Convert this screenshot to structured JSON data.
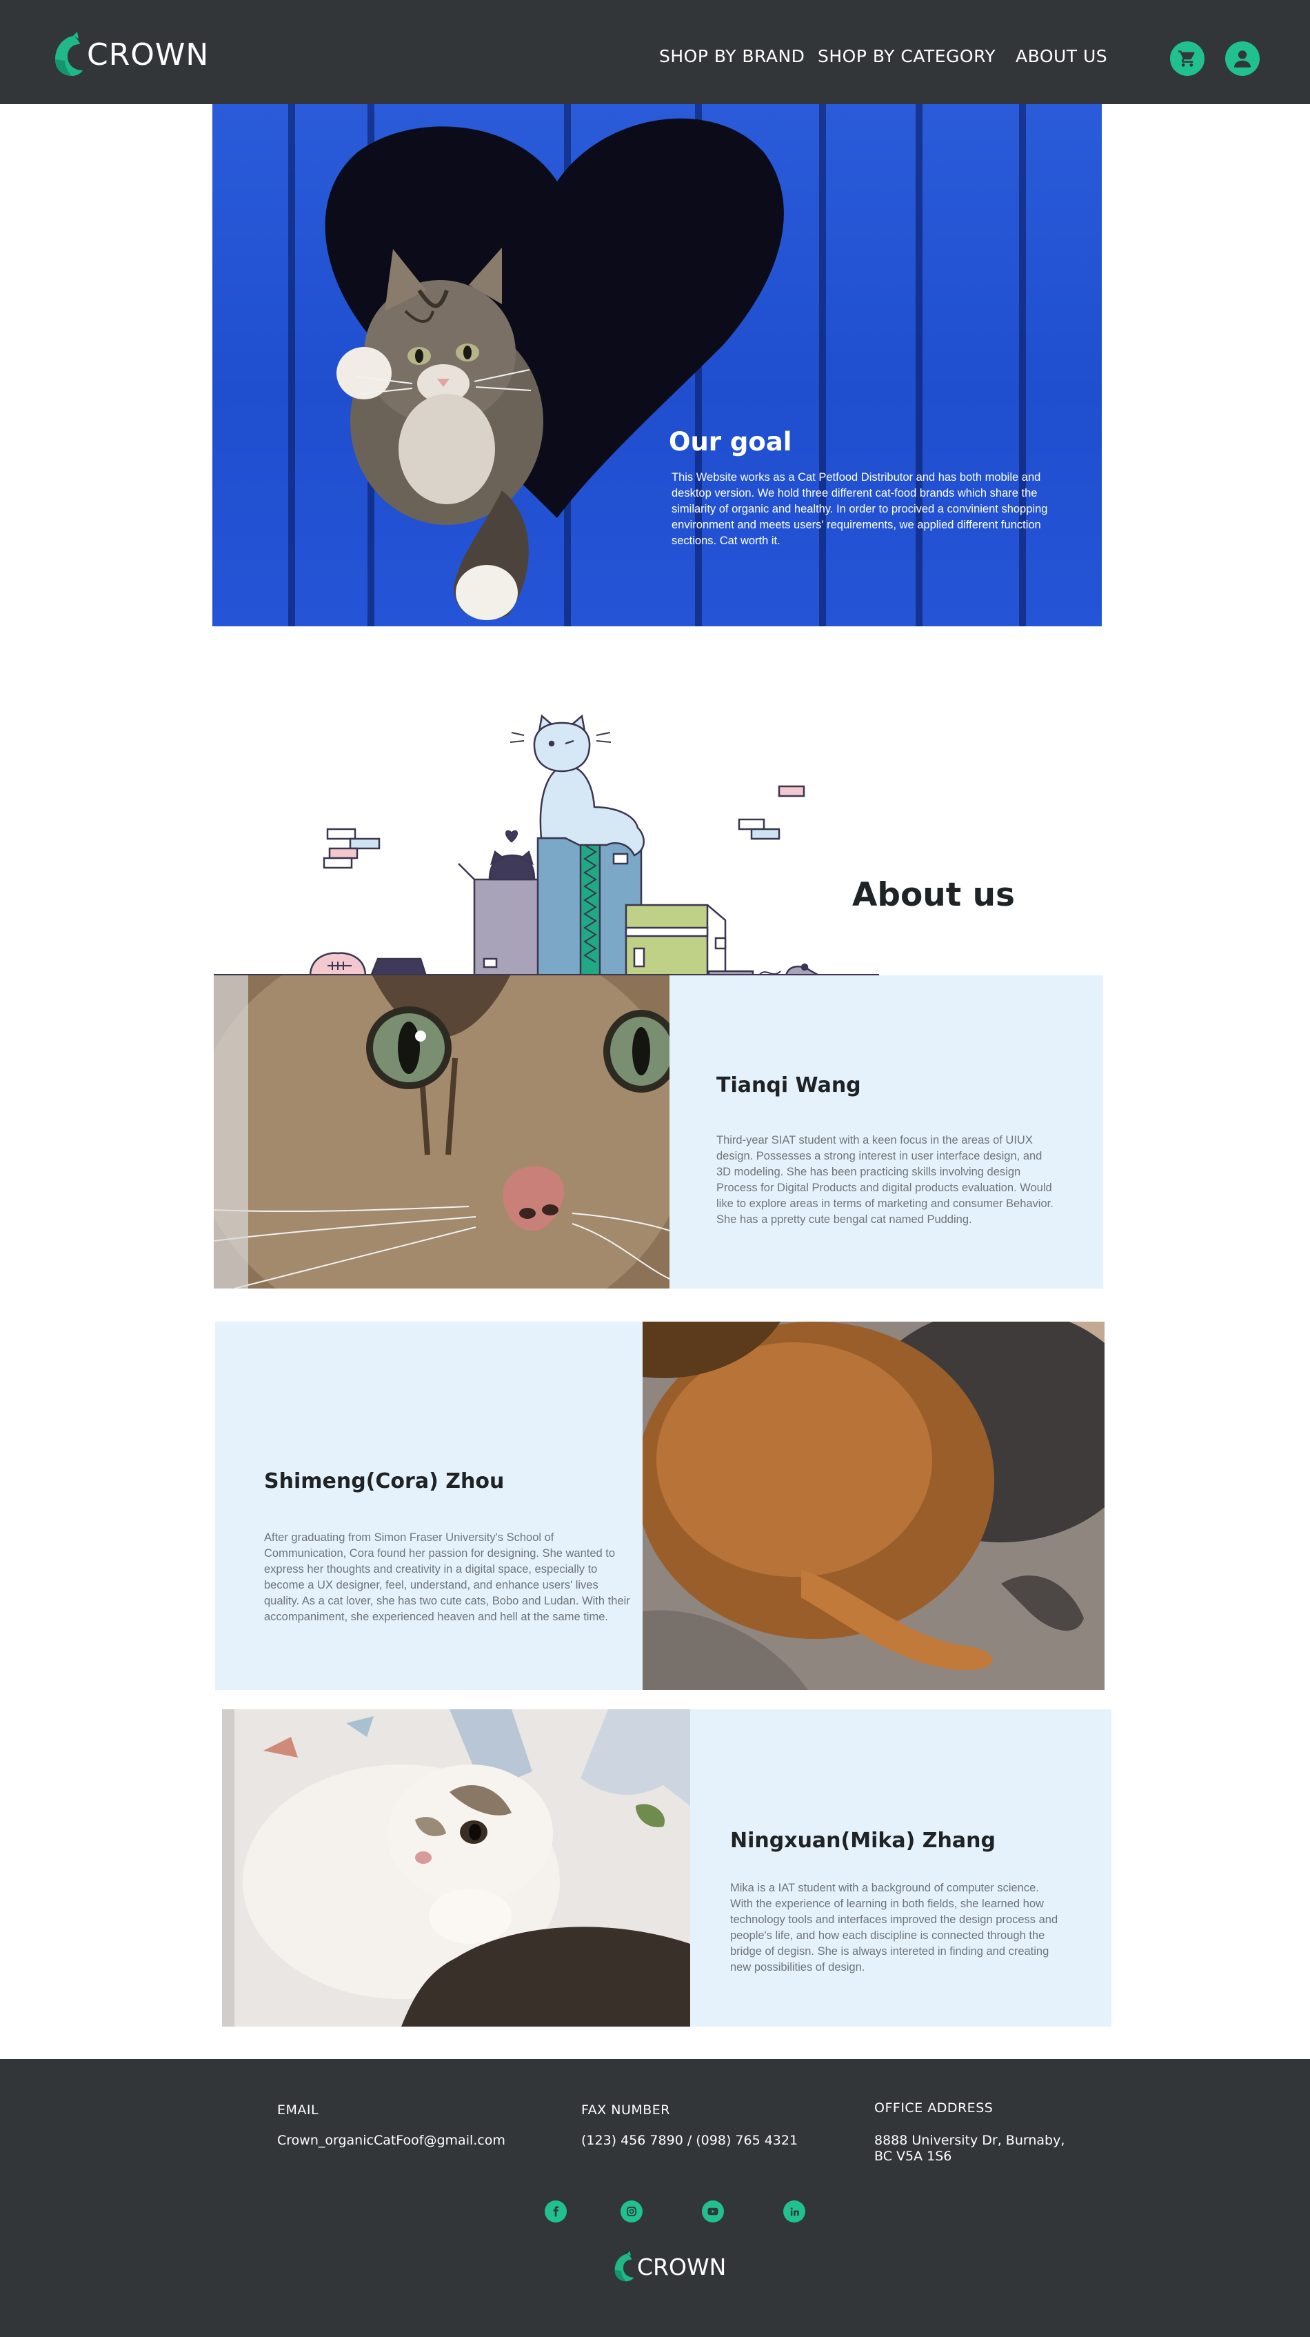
{
  "brand": {
    "name": "CROWN",
    "accent": "#21c08f",
    "dark": "#323638",
    "panel": "#e5f2fc"
  },
  "nav": {
    "items": [
      {
        "label": "SHOP BY BRAND"
      },
      {
        "label": "SHOP BY CATEGORY"
      },
      {
        "label": "ABOUT US"
      }
    ],
    "cart_icon": "shopping-cart-icon",
    "account_icon": "user-account-icon"
  },
  "hero": {
    "title": "Our goal",
    "text": "This Website works as a Cat Petfood Distributor and has both mobile and desktop version. We hold three different cat-food  brands which share the similarity of organic and healthy. In order to procived a convinient shopping environment and meets users' requirements, we applied different function sections. Cat worth it."
  },
  "about": {
    "title": "About us",
    "members": [
      {
        "name": "Tianqi Wang",
        "bio": "Third-year SIAT student with a keen focus in the areas of UIUX design. Possesses a strong interest in user interface design, and 3D modeling. She has been practicing skills involving design Process for Digital Products and digital products evaluation.  Would like to explore areas in terms of marketing and consumer Behavior. She has a ppretty cute bengal cat named Pudding."
      },
      {
        "name": "Shimeng(Cora) Zhou",
        "bio": "After graduating from Simon Fraser University's School of Communication, Cora found her passion for designing. She wanted to express her thoughts and creativity in a digital space, especially to become a UX designer, feel, understand, and enhance users' lives quality. As a cat lover, she has two cute cats, Bobo and Ludan. With their accompaniment, she experienced heaven and hell at the same time."
      },
      {
        "name": "Ningxuan(Mika) Zhang",
        "bio": "Mika is a IAT student with a background of computer science. With the experience of learning in both fields, she learned how technology tools and interfaces improved the design process and people's life, and how each discipline is connected through the bridge of degisn. She is always intereted in finding and creating new possibilities of design."
      }
    ]
  },
  "footer": {
    "email": {
      "label": "EMAIL",
      "value": "Crown_organicCatFoof@gmail.com"
    },
    "fax": {
      "label": "FAX NUMBER",
      "value": "(123) 456 7890 / (098) 765 4321"
    },
    "address": {
      "label": "OFFICE ADDRESS",
      "line1": "8888 University Dr, Burnaby,",
      "line2": "BC V5A 1S6"
    },
    "social": [
      "facebook-icon",
      "instagram-icon",
      "youtube-icon",
      "linkedin-icon"
    ],
    "logo_text": "CROWN"
  }
}
